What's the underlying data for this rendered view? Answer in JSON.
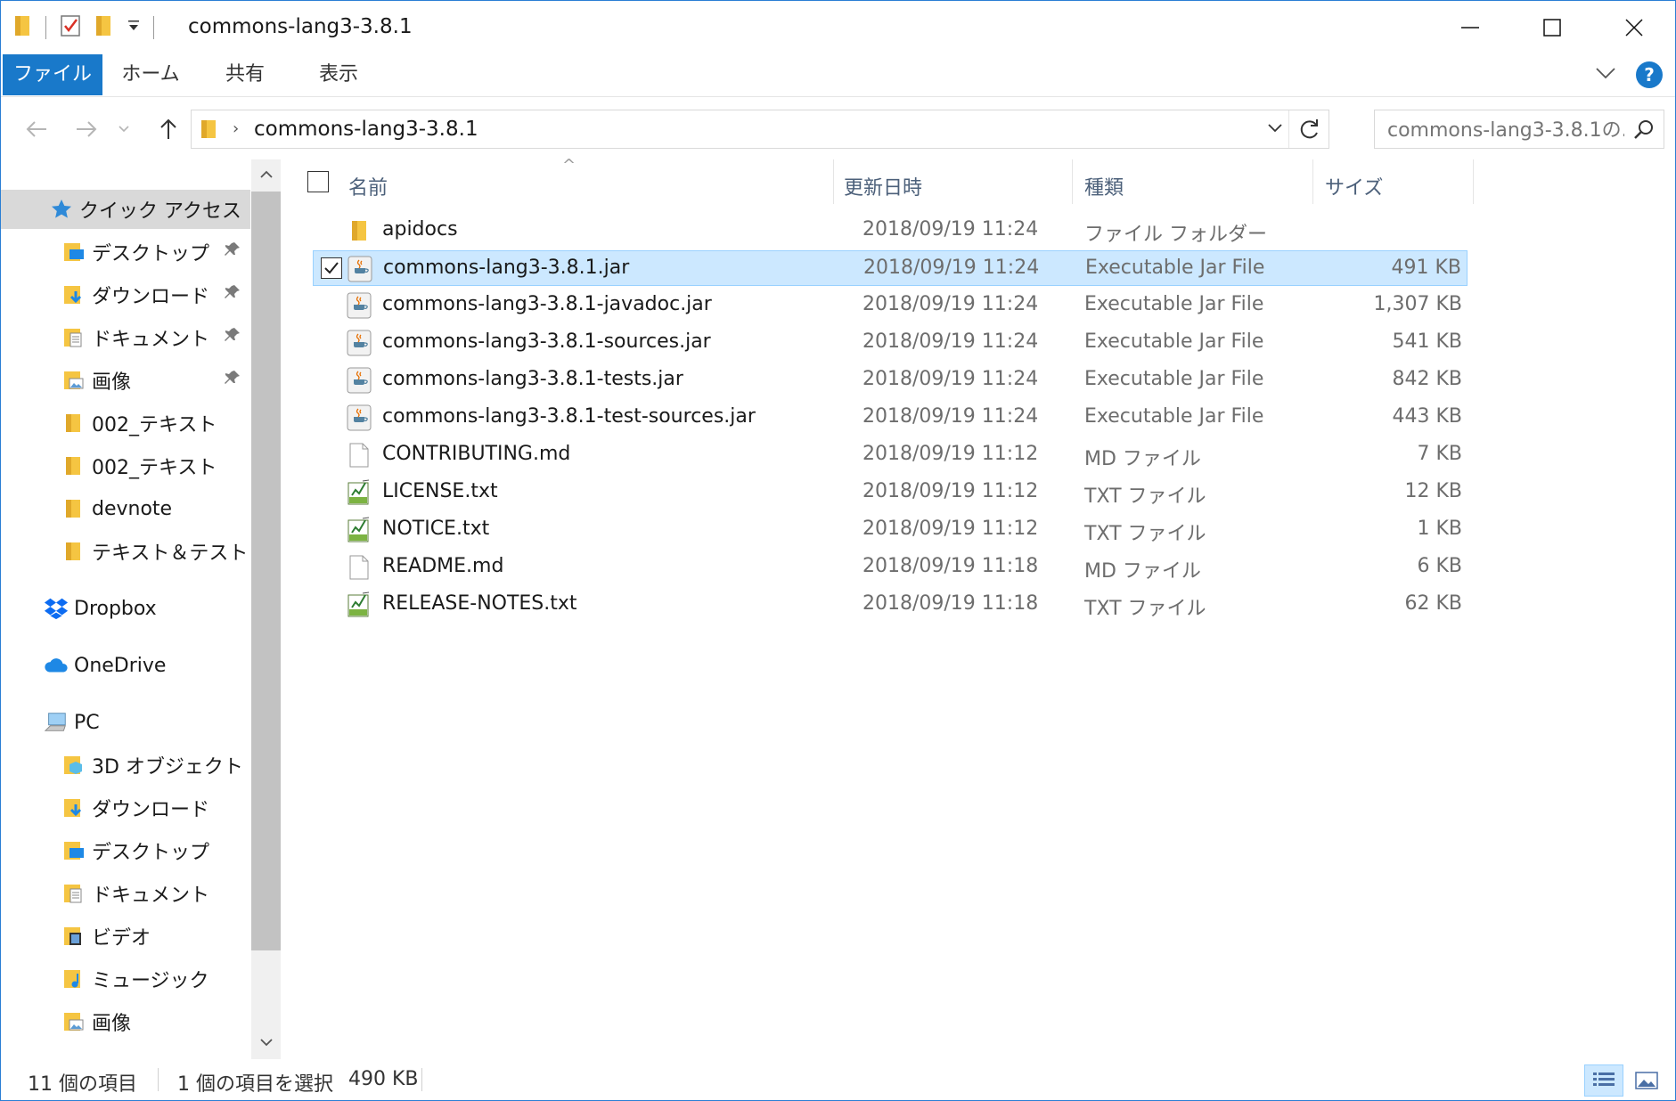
{
  "window": {
    "title": "commons-lang3-3.8.1"
  },
  "ribbon": {
    "tabs": [
      "ファイル",
      "ホーム",
      "共有",
      "表示"
    ],
    "accent": "#1979ca"
  },
  "address": {
    "path": "commons-lang3-3.8.1"
  },
  "search": {
    "placeholder": "commons-lang3-3.8.1の..."
  },
  "nav": {
    "quick_access": "クイック アクセス",
    "quick_items": [
      {
        "label": "デスクトップ",
        "icon": "desktop-folder-icon",
        "pinned": true
      },
      {
        "label": "ダウンロード",
        "icon": "downloads-folder-icon",
        "pinned": true
      },
      {
        "label": "ドキュメント",
        "icon": "documents-folder-icon",
        "pinned": true
      },
      {
        "label": "画像",
        "icon": "pictures-folder-icon",
        "pinned": true
      },
      {
        "label": "002_テキスト",
        "icon": "folder-icon",
        "pinned": false
      },
      {
        "label": "002_テキスト",
        "icon": "folder-icon",
        "pinned": false
      },
      {
        "label": "devnote",
        "icon": "folder-icon",
        "pinned": false
      },
      {
        "label": "テキスト＆テスト",
        "icon": "folder-icon",
        "pinned": false
      }
    ],
    "dropbox": "Dropbox",
    "onedrive": "OneDrive",
    "pc": "PC",
    "pc_items": [
      {
        "label": "3D オブジェクト",
        "icon": "3d-objects-folder-icon"
      },
      {
        "label": "ダウンロード",
        "icon": "downloads-folder-icon"
      },
      {
        "label": "デスクトップ",
        "icon": "desktop-folder-icon"
      },
      {
        "label": "ドキュメント",
        "icon": "documents-folder-icon"
      },
      {
        "label": "ビデオ",
        "icon": "videos-folder-icon"
      },
      {
        "label": "ミュージック",
        "icon": "music-folder-icon"
      },
      {
        "label": "画像",
        "icon": "pictures-folder-icon"
      }
    ]
  },
  "columns": {
    "name": "名前",
    "date": "更新日時",
    "type": "種類",
    "size": "サイズ"
  },
  "files": [
    {
      "name": "apidocs",
      "date": "2018/09/19 11:24",
      "type": "ファイル フォルダー",
      "size": "",
      "icon": "folder-icon",
      "selected": false
    },
    {
      "name": "commons-lang3-3.8.1.jar",
      "date": "2018/09/19 11:24",
      "type": "Executable Jar File",
      "size": "491 KB",
      "icon": "java-jar-icon",
      "selected": true
    },
    {
      "name": "commons-lang3-3.8.1-javadoc.jar",
      "date": "2018/09/19 11:24",
      "type": "Executable Jar File",
      "size": "1,307 KB",
      "icon": "java-jar-icon",
      "selected": false
    },
    {
      "name": "commons-lang3-3.8.1-sources.jar",
      "date": "2018/09/19 11:24",
      "type": "Executable Jar File",
      "size": "541 KB",
      "icon": "java-jar-icon",
      "selected": false
    },
    {
      "name": "commons-lang3-3.8.1-tests.jar",
      "date": "2018/09/19 11:24",
      "type": "Executable Jar File",
      "size": "842 KB",
      "icon": "java-jar-icon",
      "selected": false
    },
    {
      "name": "commons-lang3-3.8.1-test-sources.jar",
      "date": "2018/09/19 11:24",
      "type": "Executable Jar File",
      "size": "443 KB",
      "icon": "java-jar-icon",
      "selected": false
    },
    {
      "name": "CONTRIBUTING.md",
      "date": "2018/09/19 11:12",
      "type": "MD ファイル",
      "size": "7 KB",
      "icon": "blank-file-icon",
      "selected": false
    },
    {
      "name": "LICENSE.txt",
      "date": "2018/09/19 11:12",
      "type": "TXT ファイル",
      "size": "12 KB",
      "icon": "text-file-icon",
      "selected": false
    },
    {
      "name": "NOTICE.txt",
      "date": "2018/09/19 11:12",
      "type": "TXT ファイル",
      "size": "1 KB",
      "icon": "text-file-icon",
      "selected": false
    },
    {
      "name": "README.md",
      "date": "2018/09/19 11:18",
      "type": "MD ファイル",
      "size": "6 KB",
      "icon": "blank-file-icon",
      "selected": false
    },
    {
      "name": "RELEASE-NOTES.txt",
      "date": "2018/09/19 11:18",
      "type": "TXT ファイル",
      "size": "62 KB",
      "icon": "text-file-icon",
      "selected": false
    }
  ],
  "status": {
    "item_count": "11 個の項目",
    "selection": "1 個の項目を選択",
    "selection_size": "490 KB"
  }
}
